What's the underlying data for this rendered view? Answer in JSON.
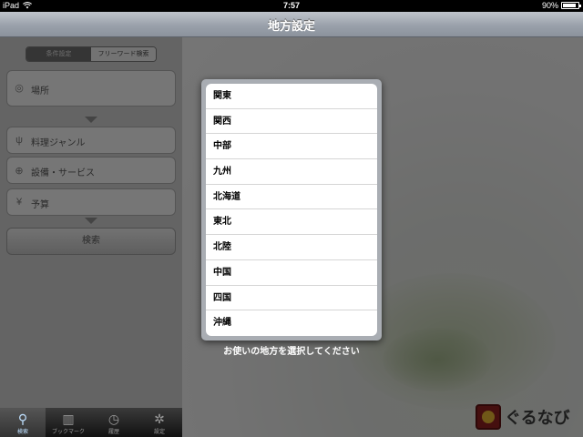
{
  "status_bar": {
    "device": "iPad",
    "time": "7:57",
    "battery": "90%",
    "battery_level": 0.9
  },
  "nav": {
    "title": "地方設定"
  },
  "left_panel": {
    "segments": [
      {
        "label": "条件設定",
        "active": true
      },
      {
        "label": "フリーワード検索",
        "active": false
      }
    ],
    "fields": {
      "location": {
        "label": "場所",
        "icon": "compass-icon"
      },
      "genre": {
        "label": "料理ジャンル",
        "icon": "fork-knife-icon"
      },
      "service": {
        "label": "設備・サービス",
        "icon": "service-icon"
      },
      "budget": {
        "label": "予算",
        "icon": "yen-icon"
      }
    },
    "search_button": "検索"
  },
  "tab_bar": {
    "tabs": [
      {
        "label": "検索",
        "icon": "search-icon",
        "active": true
      },
      {
        "label": "ブックマーク",
        "icon": "book-icon",
        "active": false
      },
      {
        "label": "履歴",
        "icon": "clock-icon",
        "active": false
      },
      {
        "label": "設定",
        "icon": "gear-icon",
        "active": false
      }
    ]
  },
  "popover": {
    "regions": [
      "関東",
      "関西",
      "中部",
      "九州",
      "北海道",
      "東北",
      "北陸",
      "中国",
      "四国",
      "沖縄"
    ],
    "caption": "お使いの地方を選択してください"
  },
  "logo": {
    "text": "ぐるなび"
  },
  "colors": {
    "nav_gradient_top": "#bfc4cb",
    "nav_gradient_bottom": "#8b929c",
    "popover_frame": "#a9adb3",
    "logo_red": "#8a1f1f"
  }
}
